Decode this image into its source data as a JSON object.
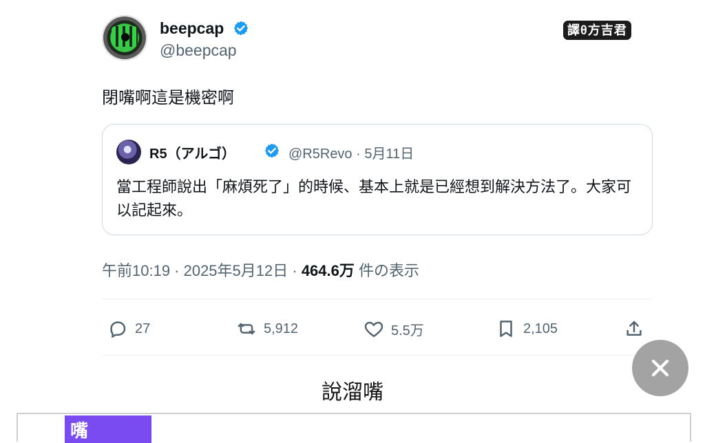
{
  "tweet": {
    "author_name": "beepcap",
    "author_handle": "@beepcap",
    "watermark": "譯θ方吉君",
    "text": "閉嘴啊這是機密啊",
    "quote": {
      "name": "R5（アルゴ）",
      "meta": "@R5Revo · 5月11日",
      "text": "當工程師說出「麻煩死了」的時候、基本上就是已經想到解決方法了。大家可以記起來。"
    },
    "timestamp": {
      "prefix": "午前10:19 · 2025年5月12日 · ",
      "views": "464.6万",
      "suffix": " 件の表示"
    },
    "actions": {
      "replies": "27",
      "retweets": "5,912",
      "likes": "5.5万",
      "bookmarks": "2,105"
    }
  },
  "caption": "說溜嘴",
  "bottom_partial_text": "嘴",
  "colors": {
    "accent_blue": "#1d9bf0",
    "text_secondary": "#536471",
    "border": "#cfd9de",
    "purple_block": "#7a4bf0",
    "fab_gray": "#a3a3a3"
  }
}
